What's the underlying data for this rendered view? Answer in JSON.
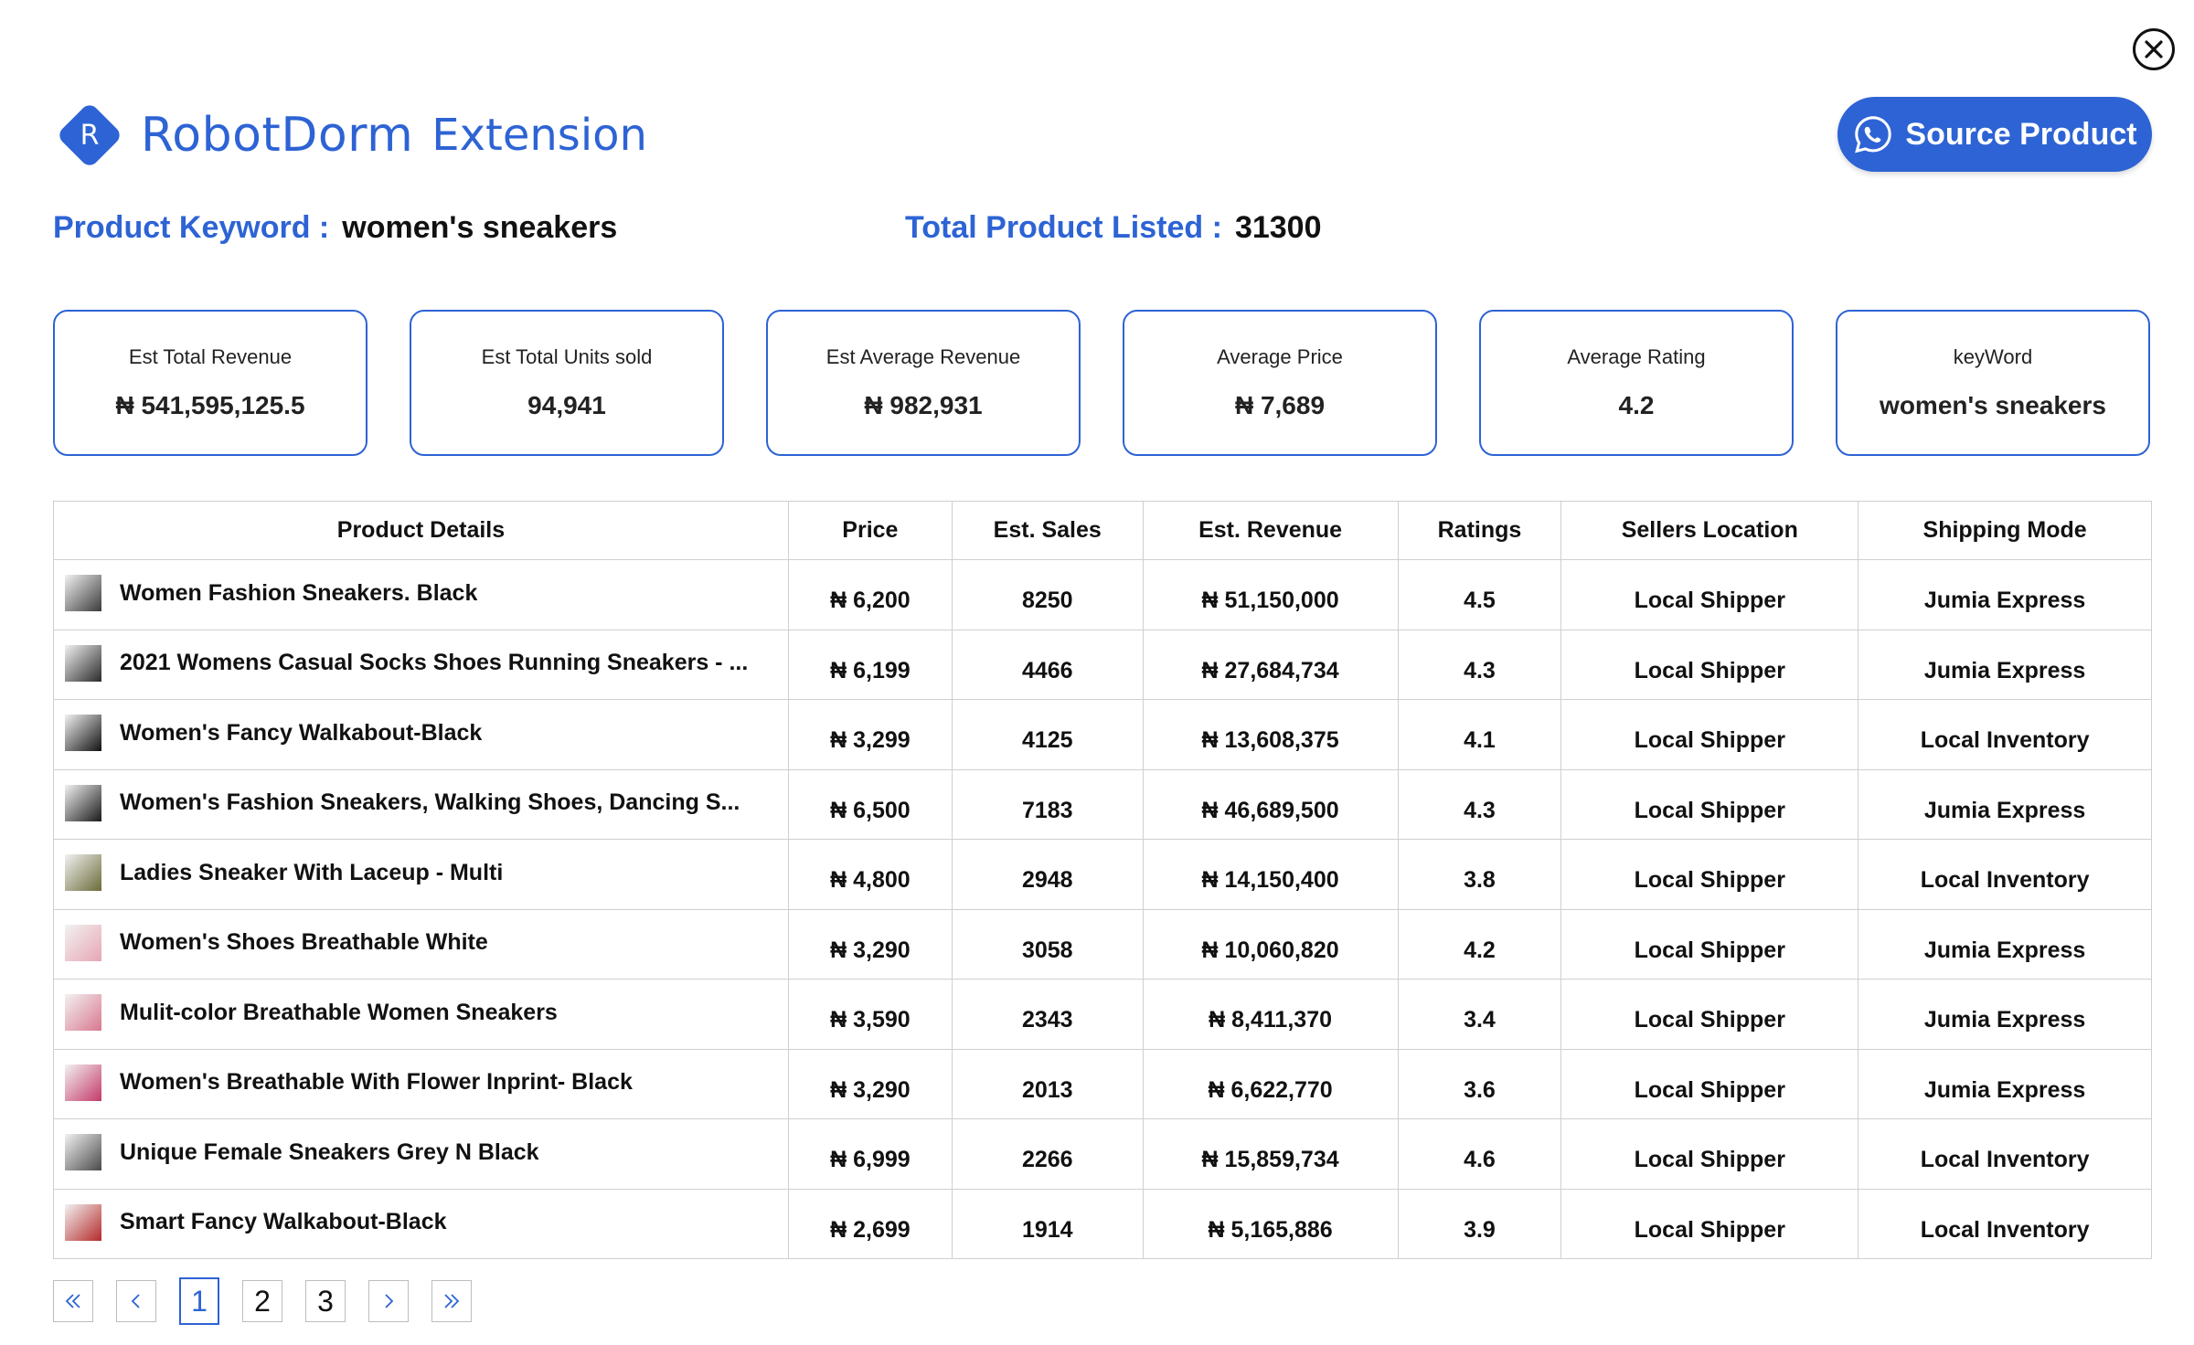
{
  "close_icon": "close-circle-icon",
  "brand": {
    "logo_letter": "R",
    "name": "RobotDorm",
    "subtitle": "Extension",
    "color": "#2d63d4"
  },
  "source_button": {
    "label": "Source Product",
    "icon": "whatsapp-icon"
  },
  "keyword_row": {
    "label": "Product Keyword :",
    "value": "women's sneakers"
  },
  "total_row": {
    "label": "Total Product Listed :",
    "value": "31300"
  },
  "cards": [
    {
      "label": "Est Total Revenue",
      "value": "₦ 541,595,125.5"
    },
    {
      "label": "Est Total Units sold",
      "value": "94,941"
    },
    {
      "label": "Est Average Revenue",
      "value": "₦ 982,931"
    },
    {
      "label": "Average Price",
      "value": "₦ 7,689"
    },
    {
      "label": "Average Rating",
      "value": "4.2"
    },
    {
      "label": "keyWord",
      "value": "women's sneakers"
    }
  ],
  "table": {
    "headers": [
      "Product Details",
      "Price",
      "Est. Sales",
      "Est. Revenue",
      "Ratings",
      "Sellers Location",
      "Shipping Mode"
    ],
    "rows": [
      {
        "product": "Women Fashion Sneakers. Black",
        "price": "₦ 6,200",
        "sales": "8250",
        "revenue": "₦ 51,150,000",
        "rating": "4.5",
        "location": "Local Shipper",
        "shipping": "Jumia Express",
        "thumb": "#3b3b3b"
      },
      {
        "product": "2021 Womens Casual Socks Shoes Running Sneakers - ...",
        "price": "₦ 6,199",
        "sales": "4466",
        "revenue": "₦ 27,684,734",
        "rating": "4.3",
        "location": "Local Shipper",
        "shipping": "Jumia Express",
        "thumb": "#2a2a2a"
      },
      {
        "product": "Women's Fancy Walkabout-Black",
        "price": "₦ 3,299",
        "sales": "4125",
        "revenue": "₦ 13,608,375",
        "rating": "4.1",
        "location": "Local Shipper",
        "shipping": "Local Inventory",
        "thumb": "#111111"
      },
      {
        "product": "Women's Fashion Sneakers, Walking Shoes, Dancing S...",
        "price": "₦ 6,500",
        "sales": "7183",
        "revenue": "₦ 46,689,500",
        "rating": "4.3",
        "location": "Local Shipper",
        "shipping": "Jumia Express",
        "thumb": "#1a1a1a"
      },
      {
        "product": "Ladies Sneaker With Laceup - Multi",
        "price": "₦ 4,800",
        "sales": "2948",
        "revenue": "₦ 14,150,400",
        "rating": "3.8",
        "location": "Local Shipper",
        "shipping": "Local Inventory",
        "thumb": "#6b6b3a"
      },
      {
        "product": "Women's Shoes Breathable White",
        "price": "₦ 3,290",
        "sales": "3058",
        "revenue": "₦ 10,060,820",
        "rating": "4.2",
        "location": "Local Shipper",
        "shipping": "Jumia Express",
        "thumb": "#e7a6b5"
      },
      {
        "product": "Mulit-color Breathable Women Sneakers",
        "price": "₦ 3,590",
        "sales": "2343",
        "revenue": "₦ 8,411,370",
        "rating": "3.4",
        "location": "Local Shipper",
        "shipping": "Jumia Express",
        "thumb": "#d9788e"
      },
      {
        "product": "Women's Breathable With Flower Inprint- Black",
        "price": "₦ 3,290",
        "sales": "2013",
        "revenue": "₦ 6,622,770",
        "rating": "3.6",
        "location": "Local Shipper",
        "shipping": "Jumia Express",
        "thumb": "#c43a6a"
      },
      {
        "product": "Unique Female Sneakers Grey N Black",
        "price": "₦ 6,999",
        "sales": "2266",
        "revenue": "₦ 15,859,734",
        "rating": "4.6",
        "location": "Local Shipper",
        "shipping": "Local Inventory",
        "thumb": "#4a4a4a"
      },
      {
        "product": "Smart Fancy Walkabout-Black",
        "price": "₦ 2,699",
        "sales": "1914",
        "revenue": "₦ 5,165,886",
        "rating": "3.9",
        "location": "Local Shipper",
        "shipping": "Local Inventory",
        "thumb": "#b52a2a"
      }
    ]
  },
  "pagination": {
    "first_icon": "double-chevron-left-icon",
    "prev_icon": "chevron-left-icon",
    "pages": [
      "1",
      "2",
      "3"
    ],
    "current_page": "1",
    "next_icon": "chevron-right-icon",
    "last_icon": "double-chevron-right-icon"
  }
}
